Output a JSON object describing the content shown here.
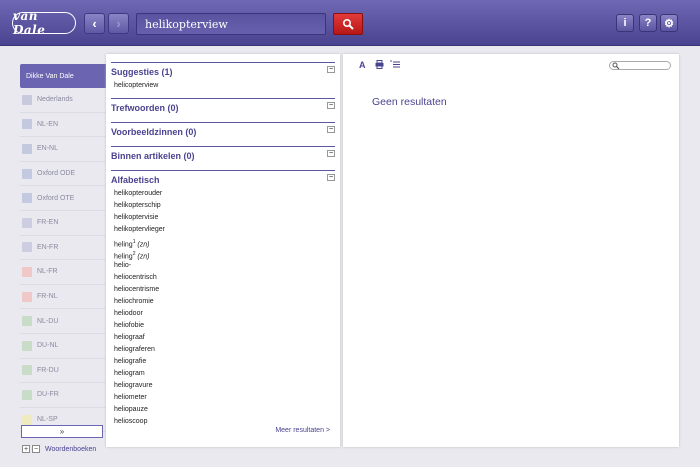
{
  "header": {
    "logo_text": "van Dale",
    "search_value": "helikopterview",
    "back_icon": "chevron-left-icon",
    "forward_icon": "chevron-right-icon",
    "search_icon": "search-icon",
    "info_icon": "info-icon",
    "help_icon": "help-icon",
    "settings_icon": "gear-icon"
  },
  "sidebar": {
    "items": [
      {
        "label": "Dikke Van Dale",
        "color": "#6b64b0"
      },
      {
        "label": "Nederlands",
        "color": "#c9c9de"
      },
      {
        "label": "NL-EN",
        "color": "#c3c9de"
      },
      {
        "label": "EN-NL",
        "color": "#c3c9de"
      },
      {
        "label": "Oxford ODE",
        "color": "#c3c9de"
      },
      {
        "label": "Oxford OTE",
        "color": "#c3c9de"
      },
      {
        "label": "FR-EN",
        "color": "#cccde0"
      },
      {
        "label": "EN-FR",
        "color": "#cccde0"
      },
      {
        "label": "NL-FR",
        "color": "#f0c8c8"
      },
      {
        "label": "FR-NL",
        "color": "#f0c8c8"
      },
      {
        "label": "NL-DU",
        "color": "#c8dcc8"
      },
      {
        "label": "DU-NL",
        "color": "#c8dcc8"
      },
      {
        "label": "FR-DU",
        "color": "#c8dcc8"
      },
      {
        "label": "DU-FR",
        "color": "#c8dcc8"
      },
      {
        "label": "NL-SP",
        "color": "#f0eac0"
      }
    ],
    "expand_glyph": "»",
    "footer_plus": "+",
    "footer_minus": "−",
    "footer_label": "Woordenboeken"
  },
  "middle": {
    "sections": [
      {
        "title": "Suggesties (1)",
        "items": [
          "helicopterview"
        ]
      },
      {
        "title": "Trefwoorden (0)",
        "items": []
      },
      {
        "title": "Voorbeeldzinnen (0)",
        "items": []
      },
      {
        "title": "Binnen artikelen (0)",
        "items": []
      }
    ],
    "alpha_title": "Alfabetisch",
    "alpha_items": [
      {
        "word": "helikopterouder"
      },
      {
        "word": "helikopterschip"
      },
      {
        "word": "helikoptervisie"
      },
      {
        "word": "helikoptervlieger"
      },
      {
        "word": "heling",
        "sup": "1",
        "pos": "(zn)"
      },
      {
        "word": "heling",
        "sup": "2",
        "pos": "(zn)"
      },
      {
        "word": "helio-"
      },
      {
        "word": "heliocentrisch"
      },
      {
        "word": "heliocentrisme"
      },
      {
        "word": "heliochromie"
      },
      {
        "word": "heliodoor"
      },
      {
        "word": "heliofobie"
      },
      {
        "word": "heliograaf"
      },
      {
        "word": "heliograferen"
      },
      {
        "word": "heliografie"
      },
      {
        "word": "heliogram"
      },
      {
        "word": "heliogravure"
      },
      {
        "word": "heliometer"
      },
      {
        "word": "heliopauze"
      },
      {
        "word": "helioscoop"
      }
    ],
    "collapse_glyph": "−",
    "more_results": "Meer resultaten >"
  },
  "right": {
    "no_results": "Geen resultaten",
    "font_tool": "A",
    "print_icon": "print-icon",
    "list_icon": "list-icon"
  }
}
